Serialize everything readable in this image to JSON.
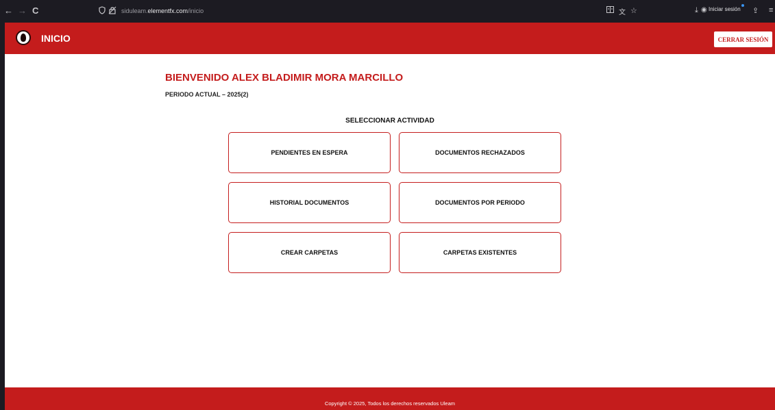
{
  "browser": {
    "back_icon": "←",
    "forward_icon": "→",
    "reload_icon": "C",
    "shield_icon": "shield-icon",
    "lock_icon": "lock-icon",
    "url_prefix": "siduleam.",
    "url_domain": "elementfx.com",
    "url_path": "/inicio",
    "sign_in_label": "Iniciar sesión"
  },
  "header": {
    "title": "INICIO",
    "logout_label": "CERRAR SESIÓN"
  },
  "main": {
    "welcome": "BIENVENIDO ALEX BLADIMIR MORA MARCILLO",
    "period": "PERIODO ACTUAL – 2025(2)",
    "select_title": "SELECCIONAR ACTIVIDAD",
    "activities": [
      "PENDIENTES EN ESPERA",
      "DOCUMENTOS RECHAZADOS",
      "HISTORIAL DOCUMENTOS",
      "DOCUMENTOS POR PERIODO",
      "CREAR CARPETAS",
      "CARPETAS EXISTENTES"
    ]
  },
  "footer": {
    "copyright": "Copyright © 2025, Todos los derechos reservados Uleam"
  },
  "colors": {
    "brand": "#c41c1c",
    "browser_chrome": "#1c1b22"
  }
}
